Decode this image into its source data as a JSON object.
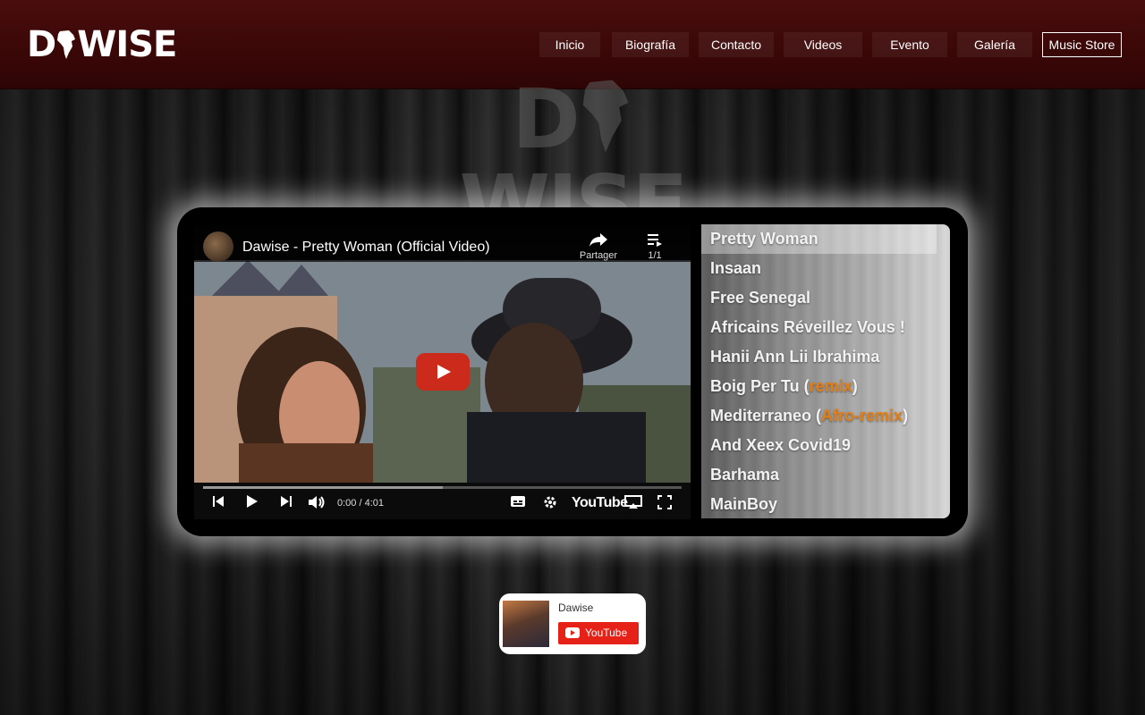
{
  "site": {
    "logo_text_left": "D",
    "logo_text_right": "WISE",
    "watermark_left": "D",
    "watermark_right": "WISE"
  },
  "nav": {
    "items": [
      "Inicio",
      "Biografía",
      "Contacto",
      "Videos",
      "Evento",
      "Galería"
    ],
    "store_label": "Music Store"
  },
  "video": {
    "channel_title": "Dawise - Pretty Woman (Official Video)",
    "share_label": "Partager",
    "queue_count": "1/1",
    "time": "0:00 / 4:01",
    "progress": 0.5,
    "youtube_label": "YouTube"
  },
  "playlist": {
    "items": [
      {
        "text": "Pretty Woman",
        "hl": "",
        "suffix": ""
      },
      {
        "text": "Insaan",
        "hl": "",
        "suffix": ""
      },
      {
        "text": "Free Senegal",
        "hl": "",
        "suffix": ""
      },
      {
        "text": "Africains Réveillez Vous !",
        "hl": "",
        "suffix": ""
      },
      {
        "text": "Hanii Ann Lii Ibrahima",
        "hl": "",
        "suffix": ""
      },
      {
        "text": "Boig Per Tu (",
        "hl": "remix",
        "suffix": ")"
      },
      {
        "text": "Mediterraneo (",
        "hl": "Afro-remix",
        "suffix": ")"
      },
      {
        "text": "And Xeex Covid19",
        "hl": "",
        "suffix": ""
      },
      {
        "text": "Barhama",
        "hl": "",
        "suffix": ""
      },
      {
        "text": "MainBoy",
        "hl": "",
        "suffix": ""
      }
    ],
    "active_index": 0,
    "highlight_color": "#e57e12"
  },
  "subscribe": {
    "channel_name": "Dawise",
    "button_label": "YouTube"
  },
  "colors": {
    "header": "#3a0707",
    "play_button": "#cc2b1c",
    "youtube_red": "#e62117"
  }
}
